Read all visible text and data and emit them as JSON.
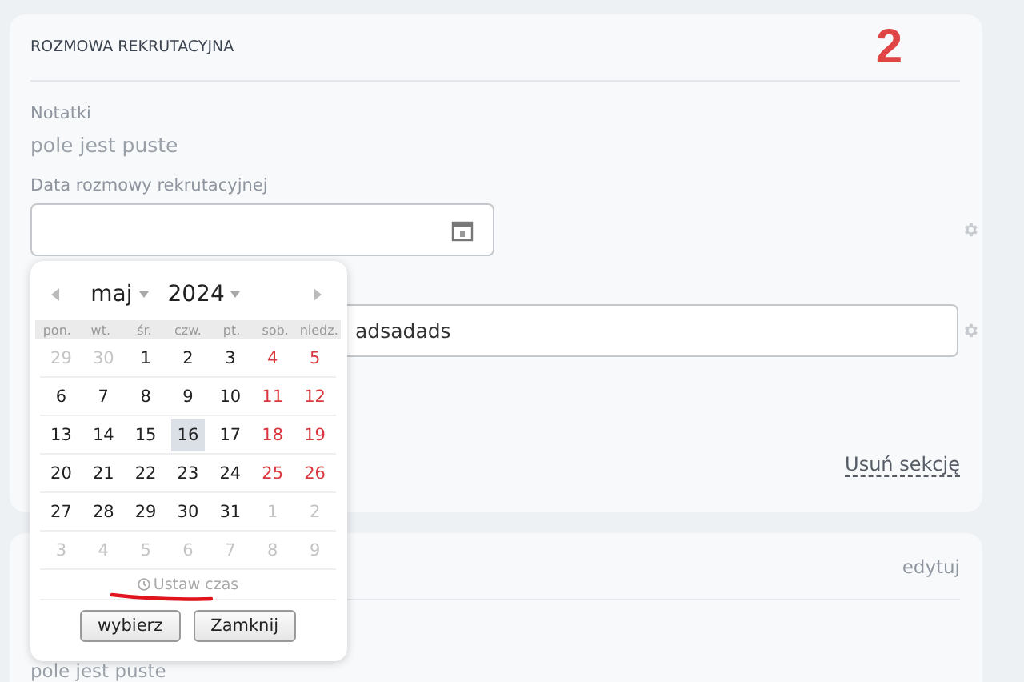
{
  "section": {
    "title": "ROZMOWA REKRUTACYJNA",
    "step_number": "2",
    "fields": [
      {
        "kind": "readonly",
        "label": "Notatki",
        "value": "pole jest puste"
      },
      {
        "kind": "date",
        "label": "Data rozmowy rekrutacyjnej"
      },
      {
        "kind": "text",
        "value": "adsadads"
      }
    ],
    "remove_link": "Usuń sekcję"
  },
  "second_section": {
    "edit_link": "edytuj",
    "value": "pole jest puste"
  },
  "datepicker": {
    "month": "maj",
    "year": "2024",
    "weekdays": [
      "pon.",
      "wt.",
      "śr.",
      "czw.",
      "pt.",
      "sob.",
      "niedz."
    ],
    "weeks": [
      [
        {
          "d": "29",
          "kind": "outside",
          "selected": false
        },
        {
          "d": "30",
          "kind": "outside",
          "selected": false
        },
        {
          "d": "1",
          "kind": "weekday",
          "selected": false
        },
        {
          "d": "2",
          "kind": "weekday",
          "selected": false
        },
        {
          "d": "3",
          "kind": "weekday",
          "selected": false
        },
        {
          "d": "4",
          "kind": "weekend",
          "selected": false
        },
        {
          "d": "5",
          "kind": "weekend",
          "selected": false
        }
      ],
      [
        {
          "d": "6",
          "kind": "weekday",
          "selected": false
        },
        {
          "d": "7",
          "kind": "weekday",
          "selected": false
        },
        {
          "d": "8",
          "kind": "weekday",
          "selected": false
        },
        {
          "d": "9",
          "kind": "weekday",
          "selected": false
        },
        {
          "d": "10",
          "kind": "weekday",
          "selected": false
        },
        {
          "d": "11",
          "kind": "weekend",
          "selected": false
        },
        {
          "d": "12",
          "kind": "weekend",
          "selected": false
        }
      ],
      [
        {
          "d": "13",
          "kind": "weekday",
          "selected": false
        },
        {
          "d": "14",
          "kind": "weekday",
          "selected": false
        },
        {
          "d": "15",
          "kind": "weekday",
          "selected": false
        },
        {
          "d": "16",
          "kind": "weekday",
          "selected": true
        },
        {
          "d": "17",
          "kind": "weekday",
          "selected": false
        },
        {
          "d": "18",
          "kind": "weekend",
          "selected": false
        },
        {
          "d": "19",
          "kind": "weekend",
          "selected": false
        }
      ],
      [
        {
          "d": "20",
          "kind": "weekday",
          "selected": false
        },
        {
          "d": "21",
          "kind": "weekday",
          "selected": false
        },
        {
          "d": "22",
          "kind": "weekday",
          "selected": false
        },
        {
          "d": "23",
          "kind": "weekday",
          "selected": false
        },
        {
          "d": "24",
          "kind": "weekday",
          "selected": false
        },
        {
          "d": "25",
          "kind": "weekend",
          "selected": false
        },
        {
          "d": "26",
          "kind": "weekend",
          "selected": false
        }
      ],
      [
        {
          "d": "27",
          "kind": "weekday",
          "selected": false
        },
        {
          "d": "28",
          "kind": "weekday",
          "selected": false
        },
        {
          "d": "29",
          "kind": "weekday",
          "selected": false
        },
        {
          "d": "30",
          "kind": "weekday",
          "selected": false
        },
        {
          "d": "31",
          "kind": "weekday",
          "selected": false
        },
        {
          "d": "1",
          "kind": "outside",
          "selected": false
        },
        {
          "d": "2",
          "kind": "outside",
          "selected": false
        }
      ],
      [
        {
          "d": "3",
          "kind": "outside",
          "selected": false
        },
        {
          "d": "4",
          "kind": "outside",
          "selected": false
        },
        {
          "d": "5",
          "kind": "outside",
          "selected": false
        },
        {
          "d": "6",
          "kind": "outside",
          "selected": false
        },
        {
          "d": "7",
          "kind": "outside",
          "selected": false
        },
        {
          "d": "8",
          "kind": "outside",
          "selected": false
        },
        {
          "d": "9",
          "kind": "outside",
          "selected": false
        }
      ]
    ],
    "set_time": "Ustaw czas",
    "buttons": [
      "wybierz",
      "Zamknij"
    ]
  }
}
